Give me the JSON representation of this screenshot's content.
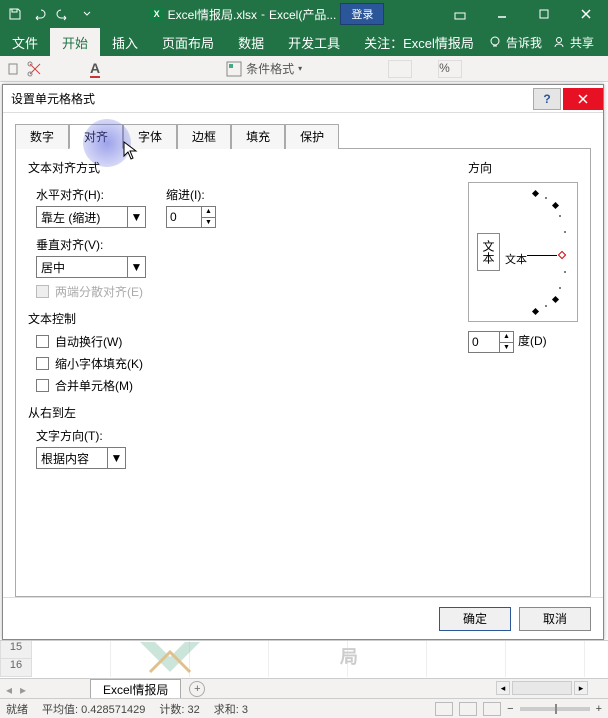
{
  "titlebar": {
    "filename": "Excel情报局.xlsx",
    "appname": "Excel(产品...",
    "login": "登录"
  },
  "ribbon": {
    "tabs": [
      "文件",
      "开始",
      "插入",
      "页面布局",
      "数据",
      "开发工具",
      "关注：Excel情报局"
    ],
    "tell_me": "告诉我",
    "share": "共享",
    "cond_format": "条件格式"
  },
  "dialog": {
    "title": "设置单元格格式",
    "tabs": [
      "数字",
      "对齐",
      "字体",
      "边框",
      "填充",
      "保护"
    ],
    "active_tab": 1,
    "align": {
      "text_align_section": "文本对齐方式",
      "h_label": "水平对齐(H):",
      "h_value": "靠左 (缩进)",
      "indent_label": "缩进(I):",
      "indent_value": "0",
      "v_label": "垂直对齐(V):",
      "v_value": "居中",
      "justify_distrib": "两端分散对齐(E)",
      "text_control_section": "文本控制",
      "wrap": "自动换行(W)",
      "shrink": "缩小字体填充(K)",
      "merge": "合并单元格(M)",
      "rtl_section": "从右到左",
      "text_dir_label": "文字方向(T):",
      "text_dir_value": "根据内容",
      "orientation_section": "方向",
      "orient_vert_text": "文本",
      "orient_horiz_text": "文本",
      "degree_value": "0",
      "degree_label": "度(D)"
    },
    "ok": "确定",
    "cancel": "取消"
  },
  "sheet": {
    "rows": [
      "15",
      "16"
    ],
    "tab_name": "Excel情报局",
    "watermark": "局"
  },
  "status": {
    "ready": "就绪",
    "avg_label": "平均值:",
    "avg": "0.428571429",
    "count_label": "计数:",
    "count": "32",
    "sum_label": "求和:",
    "sum": "3",
    "zoom": "+"
  }
}
